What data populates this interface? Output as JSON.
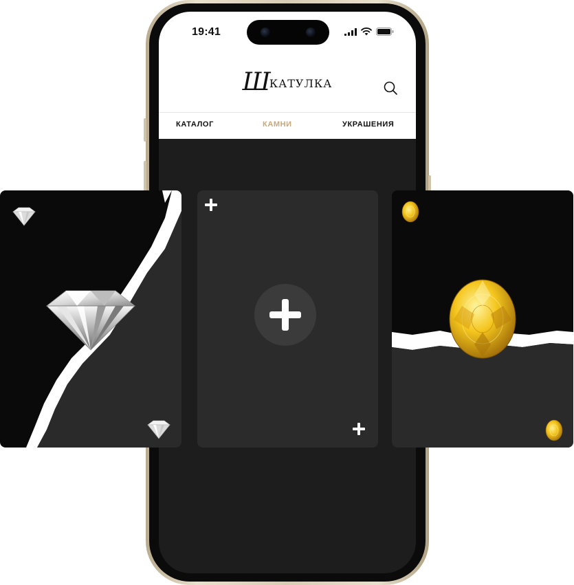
{
  "status_bar": {
    "time": "19:41"
  },
  "header": {
    "brand_script": "Ш",
    "brand_rest": "КАТУЛКА",
    "search_icon": "search-icon"
  },
  "nav": {
    "tabs": [
      {
        "label": "КАТАЛОГ",
        "active": false
      },
      {
        "label": "КАМНИ",
        "active": true
      },
      {
        "label": "УКРАШЕНИЯ",
        "active": false
      }
    ]
  },
  "cards": [
    {
      "name": "diamond-card",
      "gem": "diamond"
    },
    {
      "name": "add-card",
      "icon": "plus-icon"
    },
    {
      "name": "yellow-sapphire-card",
      "gem": "yellow-gem"
    }
  ],
  "colors": {
    "accent": "#c8a97a",
    "screen_bg": "#1d1d1d",
    "card_dark": "#0a0a0a",
    "card_mid": "#2b2b2b",
    "gem_yellow": "#f2c21b"
  }
}
